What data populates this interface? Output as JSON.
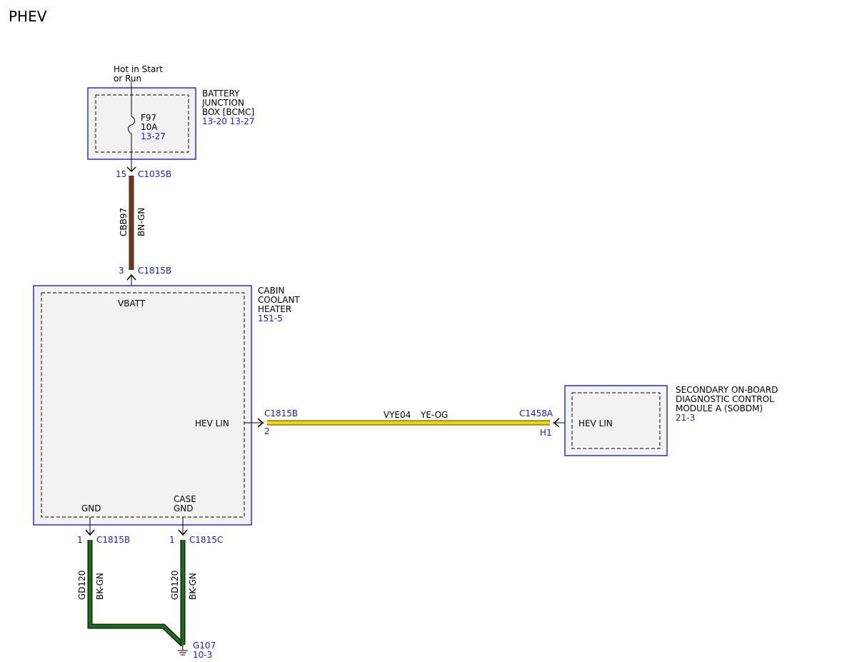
{
  "page_title": "PHEV",
  "colors": {
    "module_border": "#2b2bd6",
    "wire_brown": "#6b3a1f",
    "wire_yellow": "#f2d400",
    "wire_green": "#1f6b1f",
    "ref_blue": "#1a1adc"
  },
  "supply": {
    "line1": "Hot in Start",
    "line2": "or Run"
  },
  "bjb": {
    "name1": "BATTERY",
    "name2": "JUNCTION",
    "name3": "BOX [BCMC]",
    "refs": "13-20 13-27",
    "fuse_id": "F97",
    "fuse_rating": "10A",
    "fuse_ref": "13-27",
    "pin": "15",
    "connector": "C1035B"
  },
  "wire_cbb97": {
    "circuit": "CBB97",
    "color": "BN-GN"
  },
  "heater": {
    "name1": "CABIN",
    "name2": "COOLANT",
    "name3": "HEATER",
    "ref": "151-5",
    "vbatt_label": "VBATT",
    "vbatt_pin": "3",
    "vbatt_connector": "C1815B",
    "hevlin_label": "HEV LIN",
    "hevlin_connector": "C1815B",
    "hevlin_pin": "2",
    "gnd_label": "GND",
    "gnd_pin": "1",
    "gnd_connector": "C1815B",
    "case_label1": "CASE",
    "case_label2": "GND",
    "case_pin": "1",
    "case_connector": "C1815C"
  },
  "wire_vye04": {
    "circuit": "VYE04",
    "color": "YE-OG"
  },
  "sobdm": {
    "name1": "SECONDARY ON-BOARD",
    "name2": "DIAGNOSTIC CONTROL",
    "name3": "MODULE A (SOBDM)",
    "ref": "21-3",
    "hevlin_label": "HEV LIN",
    "connector": "C1458A",
    "pin": "H1"
  },
  "wire_gd120_a": {
    "circuit": "GD120",
    "color": "BK-GN"
  },
  "wire_gd120_b": {
    "circuit": "GD120",
    "color": "BK-GN"
  },
  "ground": {
    "id": "G107",
    "ref": "10-3"
  }
}
